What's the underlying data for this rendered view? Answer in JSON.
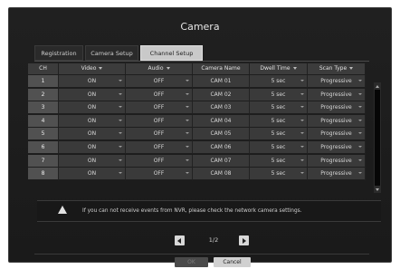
{
  "dialog": {
    "title": "Camera"
  },
  "tabs": [
    {
      "label": "Registration",
      "active": false
    },
    {
      "label": "Camera Setup",
      "active": false
    },
    {
      "label": "Channel Setup",
      "active": true
    }
  ],
  "table": {
    "headers": [
      "CH",
      "Video",
      "Audio",
      "Camera Name",
      "Dwell Time",
      "Scan Type"
    ],
    "rows": [
      {
        "ch": "1",
        "video": "ON",
        "audio": "OFF",
        "name": "CAM 01",
        "dwell": "5 sec",
        "scan": "Progressive"
      },
      {
        "ch": "2",
        "video": "ON",
        "audio": "OFF",
        "name": "CAM 02",
        "dwell": "5 sec",
        "scan": "Progressive"
      },
      {
        "ch": "3",
        "video": "ON",
        "audio": "OFF",
        "name": "CAM 03",
        "dwell": "5 sec",
        "scan": "Progressive"
      },
      {
        "ch": "4",
        "video": "ON",
        "audio": "OFF",
        "name": "CAM 04",
        "dwell": "5 sec",
        "scan": "Progressive"
      },
      {
        "ch": "5",
        "video": "ON",
        "audio": "OFF",
        "name": "CAM 05",
        "dwell": "5 sec",
        "scan": "Progressive"
      },
      {
        "ch": "6",
        "video": "ON",
        "audio": "OFF",
        "name": "CAM 06",
        "dwell": "5 sec",
        "scan": "Progressive"
      },
      {
        "ch": "7",
        "video": "ON",
        "audio": "OFF",
        "name": "CAM 07",
        "dwell": "5 sec",
        "scan": "Progressive"
      },
      {
        "ch": "8",
        "video": "ON",
        "audio": "OFF",
        "name": "CAM 08",
        "dwell": "5 sec",
        "scan": "Progressive"
      }
    ]
  },
  "notice": {
    "icon": "warning-icon",
    "text": "If you can not receive events from NVR, please check the network camera settings."
  },
  "pager": {
    "page": "1/2",
    "prev_icon": "chevron-left-icon",
    "next_icon": "chevron-right-icon"
  },
  "buttons": {
    "ok": "OK",
    "cancel": "Cancel"
  }
}
